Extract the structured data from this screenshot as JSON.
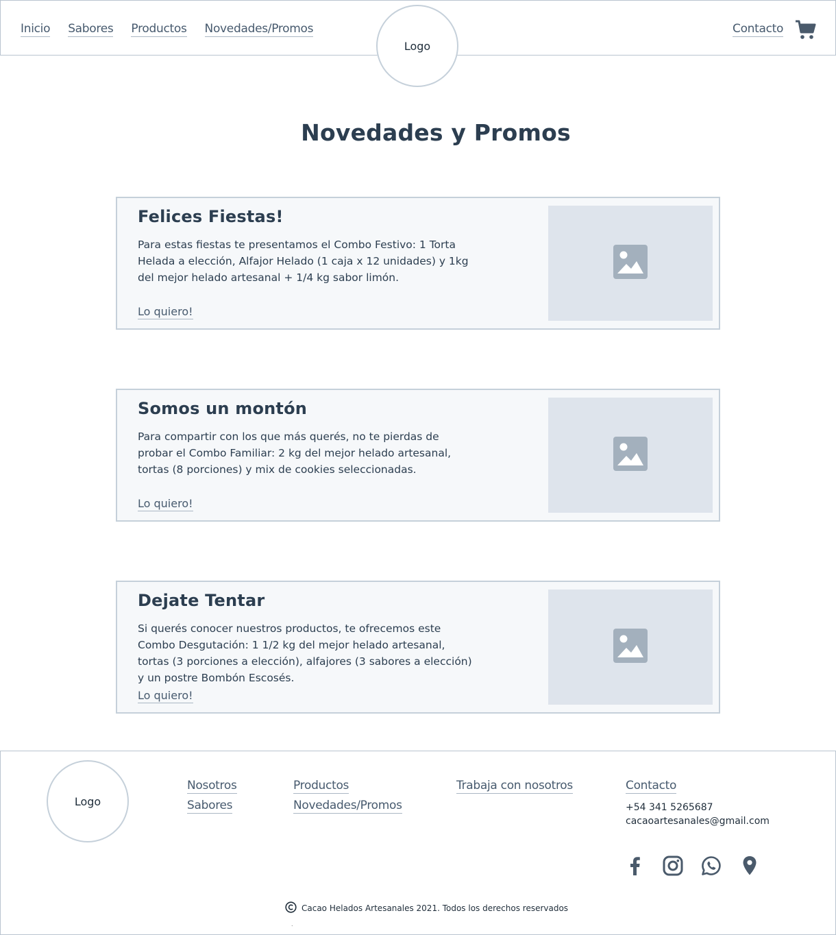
{
  "header": {
    "nav_left": [
      "Inicio",
      "Sabores",
      "Productos",
      "Novedades/Promos"
    ],
    "logo": "Logo",
    "contact": "Contacto",
    "cart_icon": "cart-icon"
  },
  "main": {
    "title": "Novedades y Promos",
    "cards": [
      {
        "title": "Felices Fiestas!",
        "text": "Para estas fiestas te presentamos el Combo Festivo: 1 Torta Helada a elección, Alfajor Helado (1 caja x 12 unidades) y 1kg del mejor helado artesanal + 1/4 kg sabor limón.",
        "cta": "Lo quiero!",
        "image_icon": "image-placeholder-icon"
      },
      {
        "title": "Somos un montón",
        "text": "Para compartir con los que más querés,  no te pierdas de probar el Combo Familiar: 2 kg del mejor helado artesanal, tortas (8 porciones) y mix de cookies seleccionadas.",
        "cta": "Lo quiero!",
        "image_icon": "image-placeholder-icon"
      },
      {
        "title": "Dejate Tentar",
        "text": "Si querés conocer nuestros productos, te ofrecemos este Combo Desgutación: 1 1/2 kg del mejor helado artesanal, tortas (3 porciones a elección), alfajores (3 sabores a elección) y un postre Bombón Escosés.",
        "cta": "Lo quiero!",
        "image_icon": "image-placeholder-icon"
      }
    ]
  },
  "footer": {
    "logo": "Logo",
    "col1": [
      "Nosotros",
      "Sabores"
    ],
    "col2": [
      "Productos",
      "Novedades/Promos"
    ],
    "col3": [
      "Trabaja con nosotros"
    ],
    "contact_label": "Contacto",
    "phone": "+54 341 5265687",
    "email": "cacaoartesanales@gmail.com",
    "socials": [
      "facebook-icon",
      "instagram-icon",
      "whatsapp-icon",
      "location-pin-icon"
    ],
    "copyright": "Cacao Helados Artesanales 2021. Todos los derechos reservados",
    "dot": "."
  },
  "colors": {
    "border": "#c5d0da",
    "card_bg": "#f6f8fa",
    "image_bg": "#dee4ec",
    "icon": "#4a5a6b",
    "image_icon": "#a3b0bd"
  }
}
